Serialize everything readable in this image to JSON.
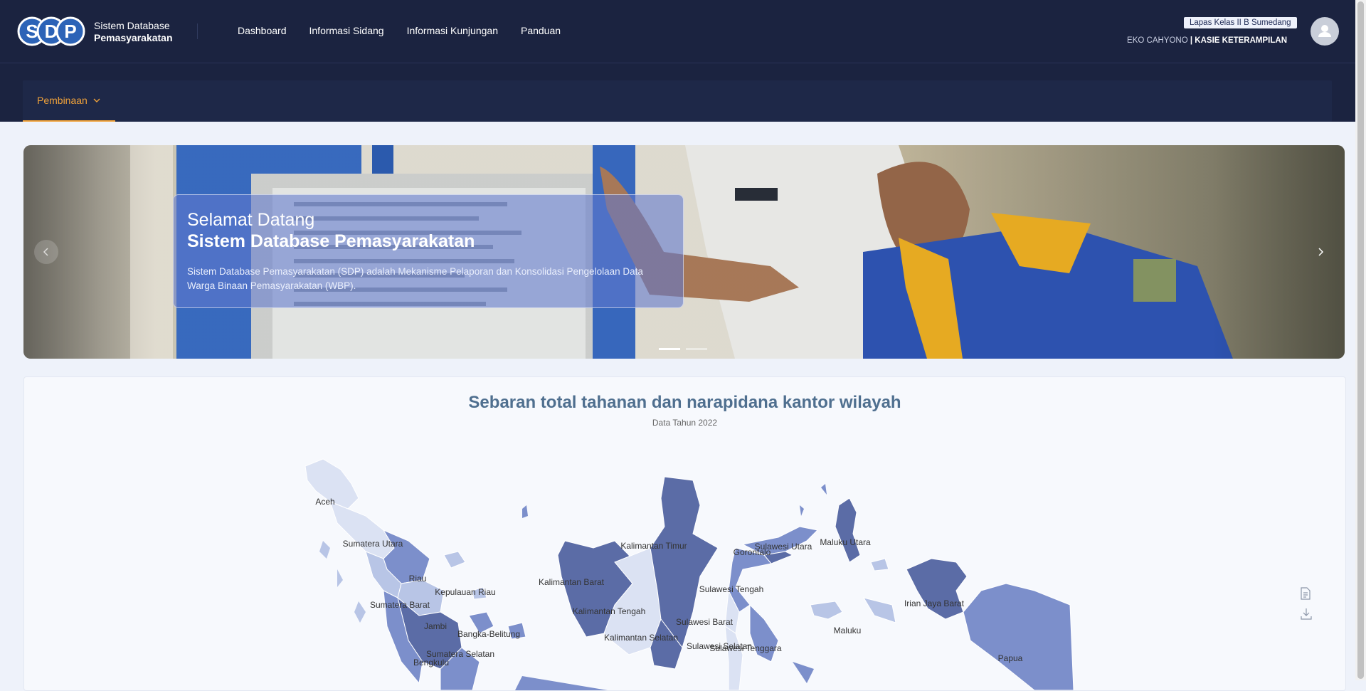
{
  "header": {
    "logo_text": "SDP",
    "brand_line1": "Sistem Database",
    "brand_line2": "Pemasyarakatan",
    "nav": [
      {
        "label": "Dashboard"
      },
      {
        "label": "Informasi Sidang"
      },
      {
        "label": "Informasi Kunjungan"
      },
      {
        "label": "Panduan"
      }
    ],
    "location_badge": "Lapas Kelas II B Sumedang",
    "user_name": "EKO CAHYONO",
    "separator": "|",
    "user_role": "KASIE KETERAMPILAN"
  },
  "subnav": {
    "tab_label": "Pembinaan",
    "tab_icon": "chevron-down-icon",
    "accent_color": "#f0a23a"
  },
  "carousel": {
    "title_line1": "Selamat Datang",
    "title_line2": "Sistem Database Pemasyarakatan",
    "description": "Sistem Database Pemasyarakatan (SDP) adalah Mekanisme Pelaporan dan Konsolidasi Pengelolaan Data Warga Binaan Pemasyarakatan (WBP).",
    "slides_count": 2,
    "active_slide": 1
  },
  "map_card": {
    "title": "Sebaran total tahanan dan narapidana kantor wilayah",
    "subtitle": "Data Tahun 2022",
    "regions": [
      "Aceh",
      "Sumatera Utara",
      "Riau",
      "Kepulauan Riau",
      "Sumatera Barat",
      "Jambi",
      "Bangka-Belitung",
      "Sumatera Selatan",
      "Bengkulu",
      "Kalimantan Timur",
      "Kalimantan Barat",
      "Kalimantan Tengah",
      "Kalimantan Selatan",
      "Sulawesi Utara",
      "Gorontalo",
      "Maluku Utara",
      "Sulawesi Tengah",
      "Sulawesi Barat",
      "Sulawesi Selatan",
      "Sulawesi Tenggara",
      "Irian Jaya Barat",
      "Maluku",
      "Papua"
    ],
    "colors": {
      "lightest": "#dbe2f3",
      "light": "#b8c5e6",
      "medium": "#7c8fcb",
      "dark": "#5b6ca6"
    },
    "export_icons": [
      "document-icon",
      "download-icon"
    ]
  }
}
